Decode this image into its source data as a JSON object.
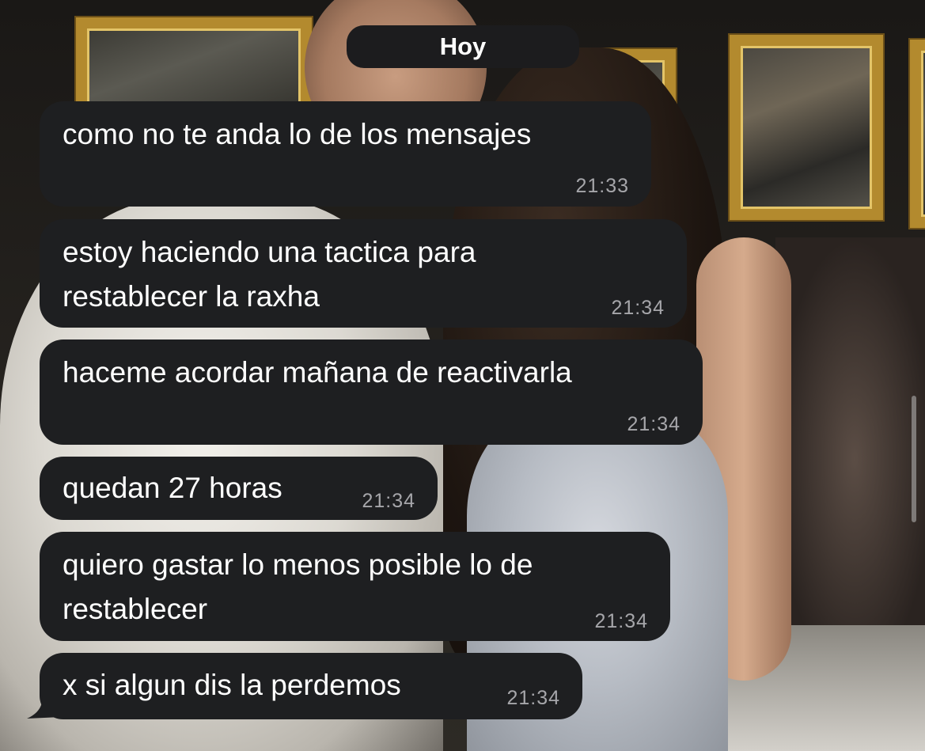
{
  "chat": {
    "date_label": "Hoy",
    "messages": [
      {
        "lines": [
          "como no te anda lo de los mensajes"
        ],
        "time": "21:33"
      },
      {
        "lines": [
          "estoy haciendo una tactica para",
          "restablecer la raxha"
        ],
        "time": "21:34"
      },
      {
        "lines": [
          "haceme acordar mañana de reactivarla"
        ],
        "time": "21:34"
      },
      {
        "lines": [
          "quedan 27 horas"
        ],
        "time": "21:34"
      },
      {
        "lines": [
          "quiero gastar lo menos posible lo de",
          "restablecer"
        ],
        "time": "21:34"
      },
      {
        "lines": [
          "x si algun dis la perdemos"
        ],
        "time": "21:34"
      }
    ]
  },
  "colors": {
    "bubble_background": "#1e1f21",
    "message_text": "#ffffff",
    "timestamp_text": "#a6a6aa",
    "date_pill_background": "#1c1c1e"
  }
}
